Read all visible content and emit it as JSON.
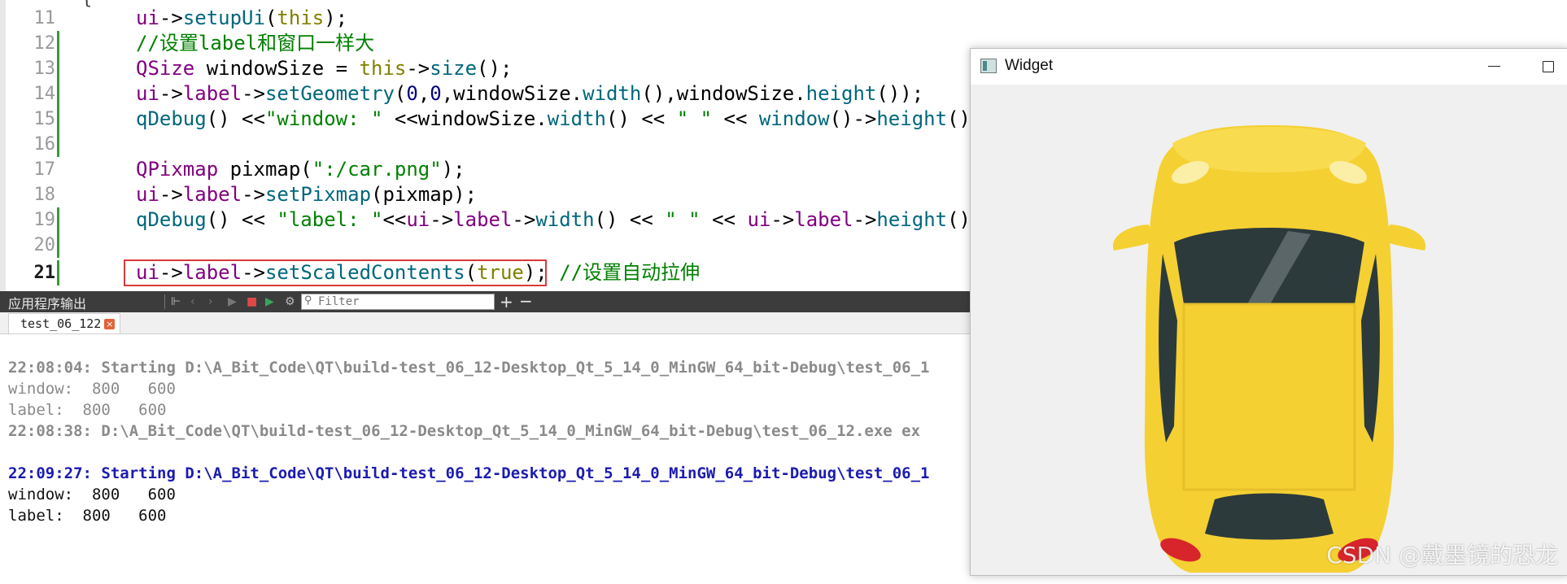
{
  "editor": {
    "lines": [
      {
        "num": "11",
        "code": "ui->setupUi(this);"
      },
      {
        "num": "12",
        "code": "//设置label和窗口一样大"
      },
      {
        "num": "13",
        "code": "QSize windowSize = this->size();"
      },
      {
        "num": "14",
        "code": "ui->label->setGeometry(0,0,windowSize.width(),windowSize.height());"
      },
      {
        "num": "15",
        "code": "qDebug() <<\"window: \" <<windowSize.width() << \" \" << window()->height()"
      },
      {
        "num": "16",
        "code": ""
      },
      {
        "num": "17",
        "code": "QPixmap pixmap(\":/car.png\");"
      },
      {
        "num": "18",
        "code": "ui->label->setPixmap(pixmap);"
      },
      {
        "num": "19",
        "code": "qDebug() << \"label: \"<<ui->label->width() << \" \" << ui->label->height()"
      },
      {
        "num": "20",
        "code": ""
      },
      {
        "num": "21",
        "code": "ui->label->setScaledContents(true); //设置自动拉伸"
      }
    ]
  },
  "output_pane": {
    "title": "应用程序输出",
    "filter_placeholder": "Filter",
    "tab_label": "test_06_122",
    "lines": [
      {
        "text": "22:08:04: Starting D:\\A_Bit_Code\\QT\\build-test_06_12-Desktop_Qt_5_14_0_MinGW_64_bit-Debug\\test_06_1",
        "style": "gray-bold"
      },
      {
        "text": "window:  800   600",
        "style": "gray"
      },
      {
        "text": "label:  800   600",
        "style": "gray"
      },
      {
        "text": "22:08:38: D:\\A_Bit_Code\\QT\\build-test_06_12-Desktop_Qt_5_14_0_MinGW_64_bit-Debug\\test_06_12.exe ex",
        "style": "gray-bold"
      },
      {
        "text": "",
        "style": "gray"
      },
      {
        "text": "22:09:27: Starting D:\\A_Bit_Code\\QT\\build-test_06_12-Desktop_Qt_5_14_0_MinGW_64_bit-Debug\\test_06_1",
        "style": "blue-bold"
      },
      {
        "text": "window:  800   600",
        "style": "black"
      },
      {
        "text": "label:  800   600",
        "style": "black"
      }
    ]
  },
  "widget_window": {
    "title": "Widget"
  },
  "watermark": "CSDN @戴墨镜的恐龙",
  "colors": {
    "car_body": "#f5d033",
    "car_glass": "#2c3a3c",
    "highlight_box": "#d83a3a"
  }
}
